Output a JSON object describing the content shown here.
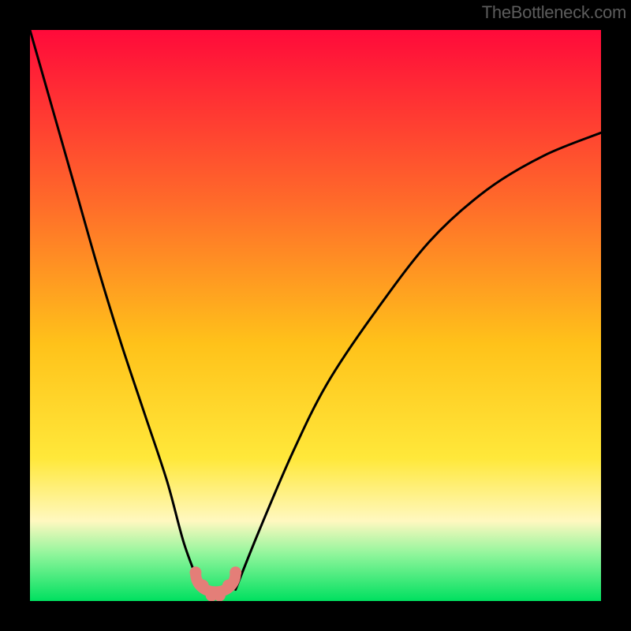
{
  "watermark": "TheBottleneck.com",
  "colors": {
    "bg": "#000000",
    "grad_top": "#ff0a3a",
    "grad_mid_upper": "#ff6a2a",
    "grad_mid": "#ffc21a",
    "grad_yellow": "#ffe83a",
    "grad_pale": "#fff8c0",
    "grad_green_light": "#8cf59a",
    "grad_green": "#00e060",
    "curve": "#000000",
    "notch_fill": "#e47e78",
    "notch_stroke": "#c45a55"
  },
  "chart_data": {
    "type": "line",
    "title": "",
    "xlabel": "",
    "ylabel": "",
    "xlim": [
      0,
      100
    ],
    "ylim": [
      0,
      100
    ],
    "series": [
      {
        "name": "bottleneck-curve-left",
        "x": [
          0,
          4,
          8,
          12,
          16,
          20,
          24,
          27,
          30
        ],
        "values": [
          100,
          86,
          72,
          58,
          45,
          33,
          21,
          10,
          2
        ]
      },
      {
        "name": "bottleneck-curve-right",
        "x": [
          36,
          40,
          46,
          52,
          60,
          70,
          80,
          90,
          100
        ],
        "values": [
          2,
          12,
          26,
          38,
          50,
          63,
          72,
          78,
          82
        ]
      }
    ],
    "notch": {
      "x_start": 29,
      "x_end": 36,
      "y": 2
    },
    "background_gradient_stops": [
      {
        "pct": 0,
        "color": "#ff0a3a"
      },
      {
        "pct": 30,
        "color": "#ff6a2a"
      },
      {
        "pct": 55,
        "color": "#ffc21a"
      },
      {
        "pct": 75,
        "color": "#ffe83a"
      },
      {
        "pct": 86,
        "color": "#fff8c0"
      },
      {
        "pct": 92,
        "color": "#8cf59a"
      },
      {
        "pct": 100,
        "color": "#00e060"
      }
    ]
  }
}
